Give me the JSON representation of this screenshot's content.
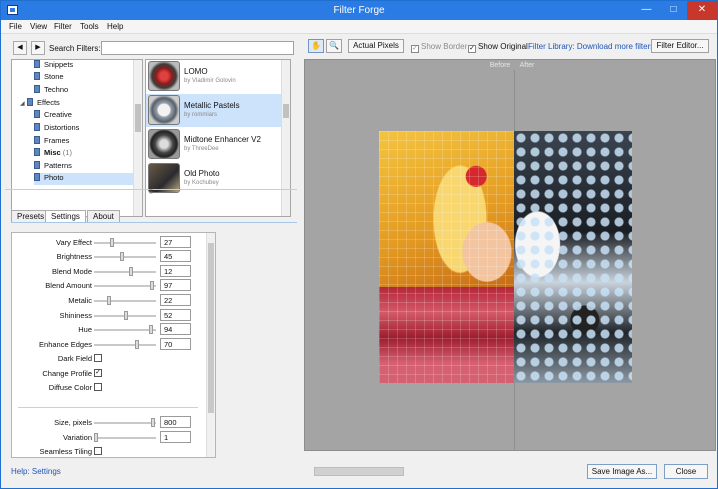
{
  "window": {
    "title": "Filter Forge",
    "minimize": "—",
    "maximize": "□",
    "close": "✕"
  },
  "menu": [
    "File",
    "View",
    "Filter",
    "Tools",
    "Help"
  ],
  "search": {
    "label": "Search Filters:",
    "value": "",
    "back": "◀",
    "forward": "▶"
  },
  "tree": [
    {
      "label": "Snippets",
      "expanded": ""
    },
    {
      "label": "Stone",
      "expanded": ""
    },
    {
      "label": "Techno",
      "expanded": ""
    },
    {
      "label": "Effects",
      "expanded": "◢"
    },
    {
      "label": "Creative",
      "expanded": ""
    },
    {
      "label": "Distortions",
      "expanded": ""
    },
    {
      "label": "Frames",
      "expanded": ""
    },
    {
      "label": "Misc",
      "count": "(1)",
      "expanded": ""
    },
    {
      "label": "Patterns",
      "expanded": ""
    },
    {
      "label": "Photo",
      "expanded": ""
    }
  ],
  "filters": [
    {
      "name": "LOMO",
      "author": "by Vladimir Golovin"
    },
    {
      "name": "Metallic Pastels",
      "author": "by rommiars"
    },
    {
      "name": "Midtone Enhancer V2",
      "author": "by ThreeDee"
    },
    {
      "name": "Old Photo",
      "author": "by Kochubey"
    }
  ],
  "tabs": [
    "Presets",
    "Settings",
    "About"
  ],
  "settings": [
    {
      "label": "Vary Effect",
      "value": "27",
      "level": 0.27
    },
    {
      "label": "Brightness",
      "value": "45",
      "level": 0.45
    },
    {
      "label": "Blend Mode",
      "value": "12",
      "level": 0.6
    },
    {
      "label": "Blend Amount",
      "value": "97",
      "level": 0.97
    },
    {
      "label": "Metalic",
      "value": "22",
      "level": 0.22
    },
    {
      "label": "Shininess",
      "value": "52",
      "level": 0.52
    },
    {
      "label": "Hue",
      "value": "94",
      "level": 0.94
    },
    {
      "label": "Enhance Edges",
      "value": "70",
      "level": 0.7
    }
  ],
  "checkboxes": [
    {
      "label": "Dark Field",
      "checked": ""
    },
    {
      "label": "Change Profile",
      "checked": "✓"
    },
    {
      "label": "Diffuse Color",
      "checked": ""
    }
  ],
  "size_settings": [
    {
      "label": "Size, pixels",
      "value": "800",
      "level": 0.98
    },
    {
      "label": "Variation",
      "value": "1",
      "level": 0.0
    }
  ],
  "seamless": {
    "label": "Seamless Tiling",
    "checked": ""
  },
  "help_link": "Help: Settings",
  "toolbar": {
    "hand_icon": "✋",
    "zoom_icon": "🔍",
    "actual_pixels": "Actual Pixels",
    "show_border": "Show Border",
    "show_border_checked": "✓",
    "show_original": "Show Original",
    "show_original_checked": "✓",
    "library_link": "Filter Library: Download more filters",
    "filter_editor": "Filter Editor..."
  },
  "preview": {
    "before": "Before",
    "after": "After"
  },
  "bottom": {
    "save": "Save Image As...",
    "close": "Close"
  },
  "splitter_grip": "⠿"
}
